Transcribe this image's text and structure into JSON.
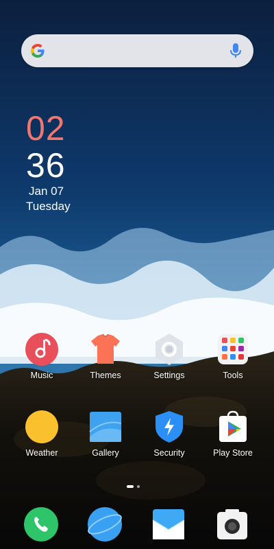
{
  "search": {
    "google_icon": "google-g-icon",
    "mic_icon": "microphone-icon"
  },
  "clock": {
    "hour": "02",
    "minute": "36",
    "date": "Jan 07",
    "day": "Tuesday"
  },
  "home_row1": [
    {
      "label": "Music",
      "icon": "music-icon",
      "color": "#e94e5b"
    },
    {
      "label": "Themes",
      "icon": "tshirt-icon",
      "color": "#fb7256"
    },
    {
      "label": "Settings",
      "icon": "gear-icon",
      "color": "#dfe3ea"
    },
    {
      "label": "Tools",
      "icon": "folder-icon",
      "color": "#f2f2f2"
    }
  ],
  "home_row2": [
    {
      "label": "Weather",
      "icon": "sun-icon",
      "color": "#fbc02d"
    },
    {
      "label": "Gallery",
      "icon": "gallery-icon",
      "color": "#3fa2ef"
    },
    {
      "label": "Security",
      "icon": "shield-icon",
      "color": "#2c8ff5"
    },
    {
      "label": "Play Store",
      "icon": "play-store-icon",
      "color": "#ffffff"
    }
  ],
  "dock": [
    {
      "icon": "phone-icon",
      "color": "#2ec46a"
    },
    {
      "icon": "browser-icon",
      "color": "#3aa0f2"
    },
    {
      "icon": "mail-icon",
      "color": "#3fa9f5"
    },
    {
      "icon": "camera-icon",
      "color": "#f2f2f2"
    }
  ],
  "page_indicator": {
    "pages": 2,
    "current": 1
  }
}
